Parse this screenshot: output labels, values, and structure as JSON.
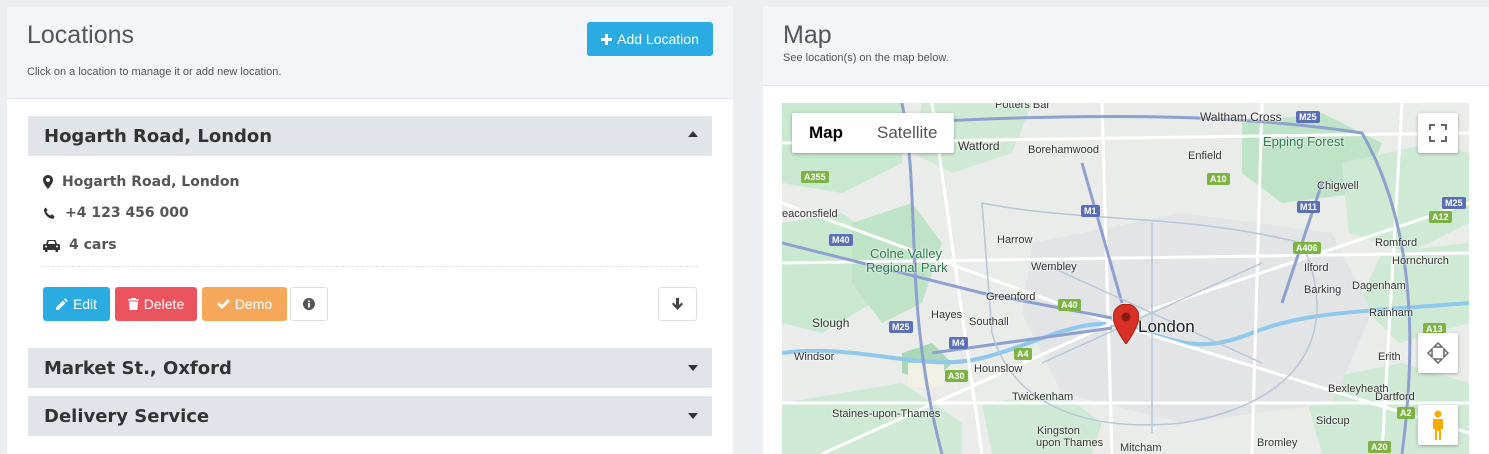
{
  "locations": {
    "title": "Locations",
    "subtitle": "Click on a location to manage it or add new location.",
    "add_button": "Add Location",
    "items": [
      {
        "name": "Hogarth Road, London"
      },
      {
        "name": "Market St., Oxford"
      },
      {
        "name": "Delivery Service"
      }
    ],
    "expanded": {
      "address": "Hogarth Road, London",
      "phone": "+4 123 456 000",
      "cars": "4 cars"
    },
    "actions": {
      "edit": "Edit",
      "delete": "Delete",
      "demo": "Demo"
    }
  },
  "map_panel": {
    "title": "Map",
    "subtitle": "See location(s) on the map below.",
    "map_type": {
      "map": "Map",
      "satellite": "Satellite"
    },
    "labels": {
      "potters_bar": "Potters Bar",
      "waltham_cross": "Waltham Cross",
      "epping_forest": "Epping Forest",
      "watford": "Watford",
      "borehamwood": "Borehamwood",
      "enfield": "Enfield",
      "chigwell": "Chigwell",
      "beaconsfield": "eaconsfield",
      "harrow": "Harrow",
      "colne1": "Colne Valley",
      "colne2": "Regional Park",
      "romford": "Romford",
      "hornchurch": "Hornchurch",
      "wembley": "Wembley",
      "ilford": "Ilford",
      "greenford": "Greenford",
      "barking": "Barking",
      "dagenham": "Dagenham",
      "slough": "Slough",
      "hayes": "Hayes",
      "southall": "Southall",
      "london": "London",
      "rainham": "Rainham",
      "windsor": "Windsor",
      "hounslow": "Hounslow",
      "erith": "Erith",
      "bexleyheath": "Bexleyheath",
      "staines": "Staines-upon-Thames",
      "twickenham": "Twickenham",
      "dartford": "Dartford",
      "kingston1": "Kingston",
      "kingston2": "upon Thames",
      "sidcup": "Sidcup",
      "bromley": "Bromley",
      "mitcham": "Mitcham"
    },
    "shields": {
      "m25a": "M25",
      "a355": "A355",
      "a10": "A10",
      "m1": "M1",
      "m11": "M11",
      "a12": "A12",
      "m25b": "M25",
      "m40": "M40",
      "a406": "A406",
      "a40": "A40",
      "m25c": "M25",
      "m4": "M4",
      "a13": "A13",
      "a4": "A4",
      "a30": "A30",
      "a2": "A2",
      "a20": "A20"
    }
  },
  "colors": {
    "accent": "#2aabe2",
    "danger": "#e9545e",
    "warning": "#f5a85a",
    "pin": "#d93025"
  }
}
